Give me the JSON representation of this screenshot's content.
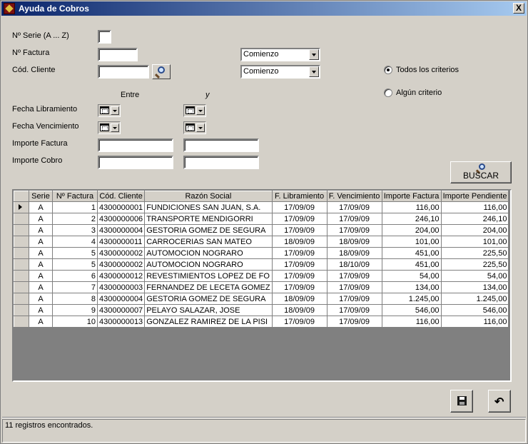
{
  "window": {
    "title": "Ayuda de Cobros",
    "close": "X"
  },
  "form": {
    "serie_label": "Nº Serie (A ... Z)",
    "factura_label": "Nº Factura",
    "cliente_label": "Cód. Cliente",
    "factura_match": "Comienzo",
    "cliente_match": "Comienzo",
    "entre_label": "Entre",
    "y_label": "y",
    "fecha_libramiento_label": "Fecha Libramiento",
    "fecha_vencimiento_label": "Fecha Vencimiento",
    "importe_factura_label": "Importe Factura",
    "importe_cobro_label": "Importe Cobro",
    "radio_all_label": "Todos los criterios",
    "radio_any_label": "Algún criterio",
    "buscar_label": "BUSCAR"
  },
  "grid": {
    "columns": [
      "Serie",
      "Nº Factura",
      "Cód. Cliente",
      "Razón Social",
      "F. Libramiento",
      "F. Vencimiento",
      "Importe Factura",
      "Importe Pendiente"
    ],
    "rows": [
      [
        "A",
        "1",
        "4300000001",
        "FUNDICIONES SAN JUAN, S.A.",
        "17/09/09",
        "17/09/09",
        "116,00",
        "116,00"
      ],
      [
        "A",
        "2",
        "4300000006",
        "TRANSPORTE MENDIGORRI",
        "17/09/09",
        "17/09/09",
        "246,10",
        "246,10"
      ],
      [
        "A",
        "3",
        "4300000004",
        "GESTORIA GOMEZ DE SEGURA",
        "17/09/09",
        "17/09/09",
        "204,00",
        "204,00"
      ],
      [
        "A",
        "4",
        "4300000011",
        "CARROCERIAS SAN MATEO",
        "18/09/09",
        "18/09/09",
        "101,00",
        "101,00"
      ],
      [
        "A",
        "5",
        "4300000002",
        "AUTOMOCION NOGRARO",
        "17/09/09",
        "18/09/09",
        "451,00",
        "225,50"
      ],
      [
        "A",
        "5",
        "4300000002",
        "AUTOMOCION NOGRARO",
        "17/09/09",
        "18/10/09",
        "451,00",
        "225,50"
      ],
      [
        "A",
        "6",
        "4300000012",
        "REVESTIMIENTOS LOPEZ DE FO",
        "17/09/09",
        "17/09/09",
        "54,00",
        "54,00"
      ],
      [
        "A",
        "7",
        "4300000003",
        "FERNANDEZ DE LECETA GOMEZ",
        "17/09/09",
        "17/09/09",
        "134,00",
        "134,00"
      ],
      [
        "A",
        "8",
        "4300000004",
        "GESTORIA GOMEZ DE SEGURA",
        "18/09/09",
        "17/09/09",
        "1.245,00",
        "1.245,00"
      ],
      [
        "A",
        "9",
        "4300000007",
        "PELAYO SALAZAR, JOSE",
        "18/09/09",
        "17/09/09",
        "546,00",
        "546,00"
      ],
      [
        "A",
        "10",
        "4300000013",
        "GONZALEZ RAMIREZ DE LA PISI",
        "17/09/09",
        "17/09/09",
        "116,00",
        "116,00"
      ]
    ]
  },
  "status": {
    "text": "11 registros encontrados."
  },
  "icons": {
    "app": "app-icon",
    "search": "search-icon",
    "save": "save-icon",
    "undo": "undo-icon",
    "calendar": "calendar-icon"
  }
}
